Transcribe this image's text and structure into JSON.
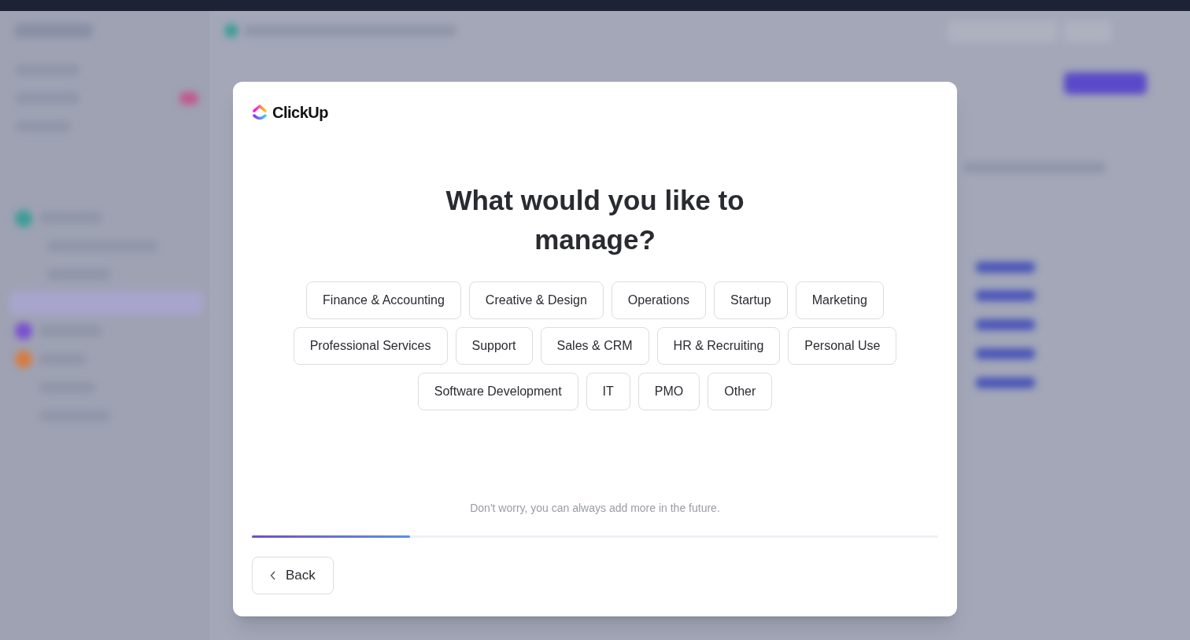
{
  "logo": {
    "text": "ClickUp"
  },
  "title": "What would you like to manage?",
  "options": [
    {
      "label": "Finance & Accounting",
      "selected": false
    },
    {
      "label": "Creative & Design",
      "selected": false
    },
    {
      "label": "Operations",
      "selected": false
    },
    {
      "label": "Startup",
      "selected": false
    },
    {
      "label": "Marketing",
      "selected": false
    },
    {
      "label": "Professional Services",
      "selected": false
    },
    {
      "label": "Support",
      "selected": false
    },
    {
      "label": "Sales & CRM",
      "selected": false
    },
    {
      "label": "HR & Recruiting",
      "selected": false
    },
    {
      "label": "Personal Use",
      "selected": false
    },
    {
      "label": "Software Development",
      "selected": false
    },
    {
      "label": "IT",
      "selected": false
    },
    {
      "label": "PMO",
      "selected": false
    },
    {
      "label": "Other",
      "selected": false
    }
  ],
  "note": "Don't worry, you can always add more in the future.",
  "progress": {
    "level": 0.23
  },
  "back_button": {
    "label": "Back"
  }
}
